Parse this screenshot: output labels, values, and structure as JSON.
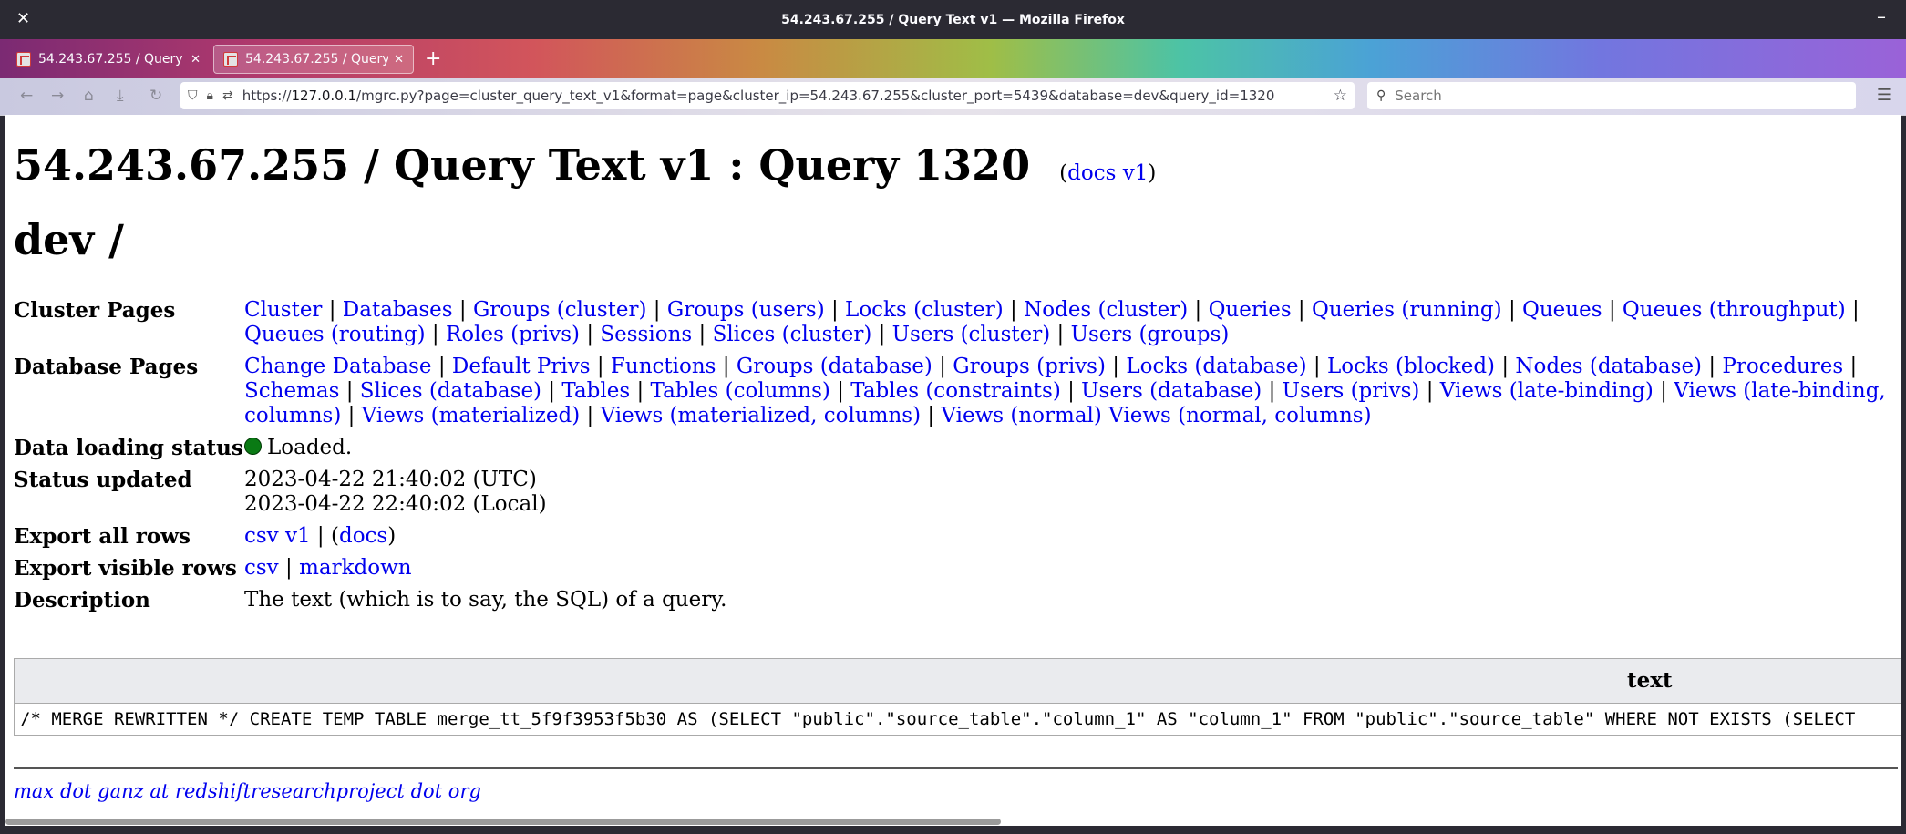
{
  "window": {
    "title": "54.243.67.255 / Query Text v1 — Mozilla Firefox"
  },
  "tabs": [
    {
      "label": "54.243.67.255 / Query Text v1"
    },
    {
      "label": "54.243.67.255 / Query Text v1"
    }
  ],
  "navbar": {
    "url_prefix": "https://",
    "url_host": "127.0.0.1",
    "url_rest": "/mgrc.py?page=cluster_query_text_v1&format=page&cluster_ip=54.243.67.255&cluster_port=5439&database=dev&query_id=1320",
    "search_placeholder": "Search"
  },
  "page": {
    "title": "54.243.67.255 / Query Text v1 : Query 1320",
    "docs_open": "(",
    "docs_link": "docs v1",
    "docs_close": ")",
    "subtitle": "dev /",
    "cluster_pages_label": "Cluster Pages",
    "cluster_pages": [
      "Cluster",
      "Databases",
      "Groups (cluster)",
      "Groups (users)",
      "Locks (cluster)",
      "Nodes (cluster)",
      "Queries",
      "Queries (running)",
      "Queues",
      "Queues (throughput)",
      "Queues (routing)",
      "Roles (privs)",
      "Sessions",
      "Slices (cluster)",
      "Users (cluster)",
      "Users (groups)"
    ],
    "database_pages_label": "Database Pages",
    "database_pages": [
      "Change Database",
      "Default Privs",
      "Functions",
      "Groups (database)",
      "Groups (privs)",
      "Locks (database)",
      "Locks (blocked)",
      "Nodes (database)",
      "Procedures",
      "Schemas",
      "Slices (database)",
      "Tables",
      "Tables (columns)",
      "Tables (constraints)",
      "Users (database)",
      "Users (privs)",
      "Views (late-binding)",
      "Views (late-binding, columns)",
      "Views (materialized)",
      "Views (materialized, columns)",
      "Views (normal) Views (normal, columns)"
    ],
    "loading_label": "Data loading status",
    "loading_value": "Loaded.",
    "status_label": "Status updated",
    "status_utc": "2023-04-22 21:40:02 (UTC)",
    "status_local": "2023-04-22 22:40:02 (Local)",
    "export_all_label": "Export all rows",
    "export_all_csv": "csv v1",
    "export_all_sep": " | (",
    "export_all_docs": "docs",
    "export_all_end": ")",
    "export_visible_label": "Export visible rows",
    "export_visible_csv": "csv",
    "export_visible_sep": " | ",
    "export_visible_md": "markdown",
    "description_label": "Description",
    "description_value": "The text (which is to say, the SQL) of a query.",
    "table_header": "text",
    "table_row": "/* MERGE REWRITTEN */ CREATE TEMP TABLE merge_tt_5f9f3953f5b30 AS (SELECT \"public\".\"source_table\".\"column_1\" AS \"column_1\" FROM \"public\".\"source_table\" WHERE NOT EXISTS (SELECT",
    "footer": "max dot ganz at redshiftresearchproject dot org"
  }
}
